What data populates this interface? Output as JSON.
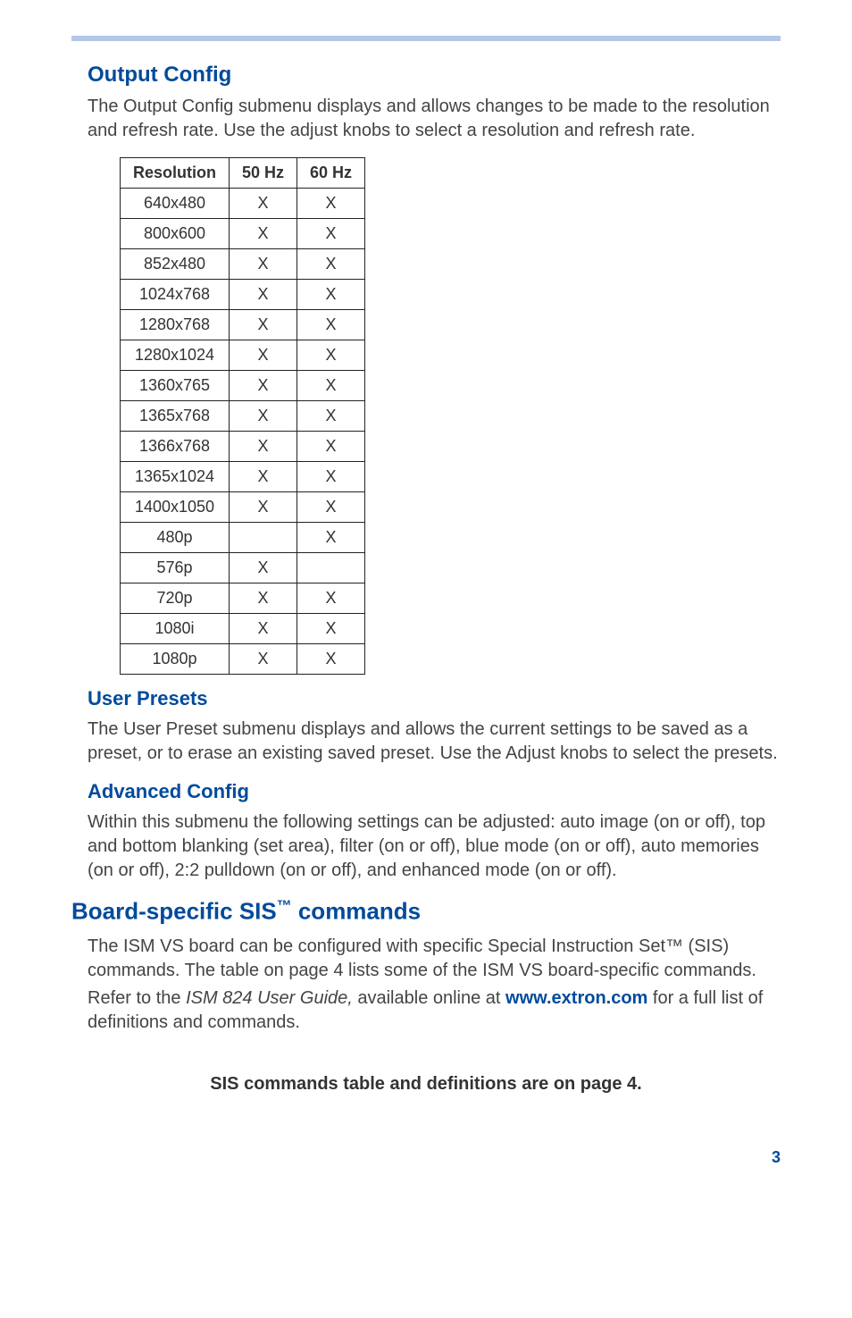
{
  "sections": {
    "output_config": {
      "heading": "Output Config",
      "body": "The Output Config submenu displays and allows changes to be made to the resolution and refresh rate. Use the adjust knobs to select a resolution and refresh rate."
    },
    "user_presets": {
      "heading": "User Presets",
      "body": "The User Preset submenu displays and allows the current settings to be saved as a preset, or to erase an existing saved preset. Use the Adjust knobs to select the presets."
    },
    "adv_config": {
      "heading": "Advanced Config",
      "body": "Within this submenu the following settings can be adjusted: auto image (on or off), top and bottom blanking (set area), filter (on or off), blue mode (on or off), auto memories (on or off), 2:2 pulldown (on or off), and enhanced mode (on or off)."
    },
    "board_sis": {
      "heading_pre": "Board-specific SIS",
      "heading_tm": "™",
      "heading_post": " commands",
      "body1": "The ISM VS board can be configured with specific Special Instruction Set™ (SIS) commands. The table on page 4 lists some of the ISM VS board-specific commands.",
      "body2_pre": "Refer to the ",
      "body2_ital": "ISM 824 User Guide,",
      "body2_mid": " available online at ",
      "link_text": "www.extron.com",
      "body2_post": " for a full list of definitions and commands."
    }
  },
  "chart_data": {
    "type": "table",
    "title": "",
    "headers": [
      "Resolution",
      "50 Hz",
      "60 Hz"
    ],
    "rows": [
      {
        "resolution": "640x480",
        "hz50": "X",
        "hz60": "X"
      },
      {
        "resolution": "800x600",
        "hz50": "X",
        "hz60": "X"
      },
      {
        "resolution": "852x480",
        "hz50": "X",
        "hz60": "X"
      },
      {
        "resolution": "1024x768",
        "hz50": "X",
        "hz60": "X"
      },
      {
        "resolution": "1280x768",
        "hz50": "X",
        "hz60": "X"
      },
      {
        "resolution": "1280x1024",
        "hz50": "X",
        "hz60": "X"
      },
      {
        "resolution": "1360x765",
        "hz50": "X",
        "hz60": "X"
      },
      {
        "resolution": "1365x768",
        "hz50": "X",
        "hz60": "X"
      },
      {
        "resolution": "1366x768",
        "hz50": "X",
        "hz60": "X"
      },
      {
        "resolution": "1365x1024",
        "hz50": "X",
        "hz60": "X"
      },
      {
        "resolution": "1400x1050",
        "hz50": "X",
        "hz60": "X"
      },
      {
        "resolution": "480p",
        "hz50": "",
        "hz60": "X"
      },
      {
        "resolution": "576p",
        "hz50": "X",
        "hz60": ""
      },
      {
        "resolution": "720p",
        "hz50": "X",
        "hz60": "X"
      },
      {
        "resolution": "1080i",
        "hz50": "X",
        "hz60": "X"
      },
      {
        "resolution": "1080p",
        "hz50": "X",
        "hz60": "X"
      }
    ]
  },
  "footer_note": "SIS commands table and definitions are on page 4.",
  "page_number": "3"
}
